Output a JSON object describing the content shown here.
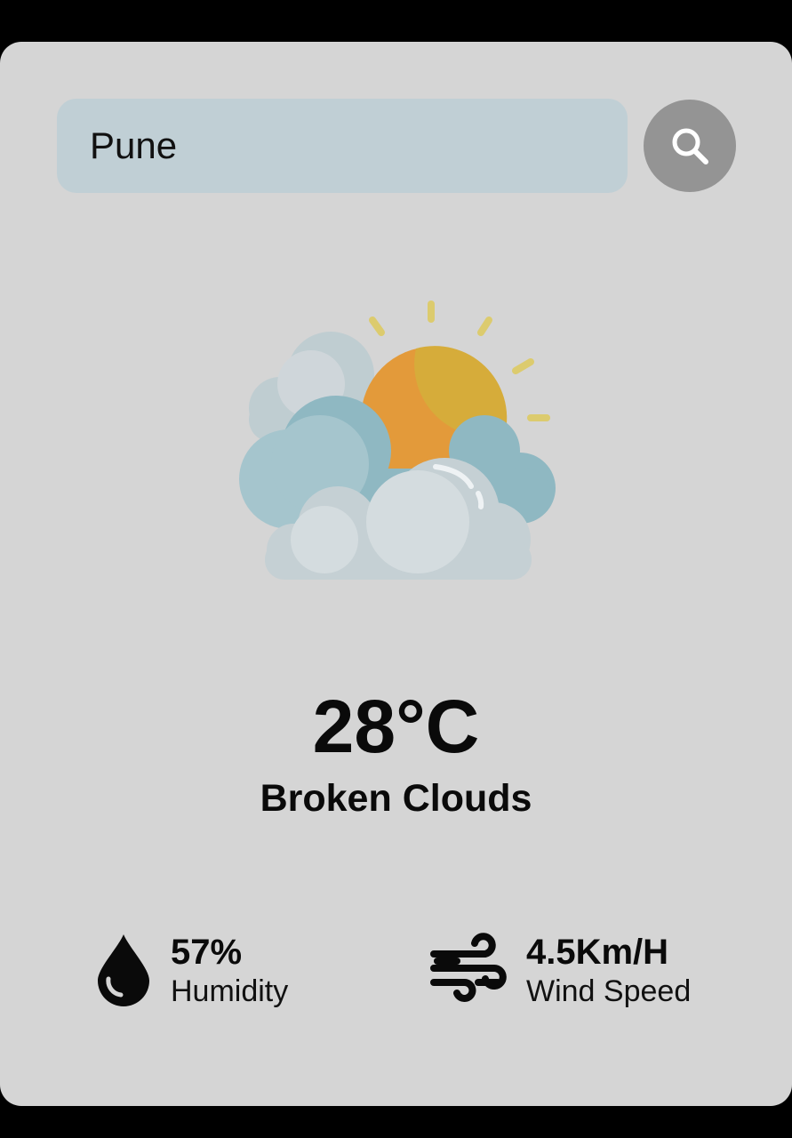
{
  "search": {
    "value": "Pune",
    "icon": "search-icon"
  },
  "weather": {
    "icon": "sun-behind-clouds-icon",
    "temperature": "28°C",
    "condition": "Broken Clouds"
  },
  "details": {
    "humidity": {
      "icon": "water-drop-icon",
      "value": "57%",
      "label": "Humidity"
    },
    "wind": {
      "icon": "wind-icon",
      "value": "4.5Km/H",
      "label": "Wind Speed"
    }
  },
  "colors": {
    "background": "#000000",
    "card": "#d5d5d5",
    "search_field": "#c0cfd5",
    "search_button": "#949494",
    "text": "#0a0a0a"
  }
}
